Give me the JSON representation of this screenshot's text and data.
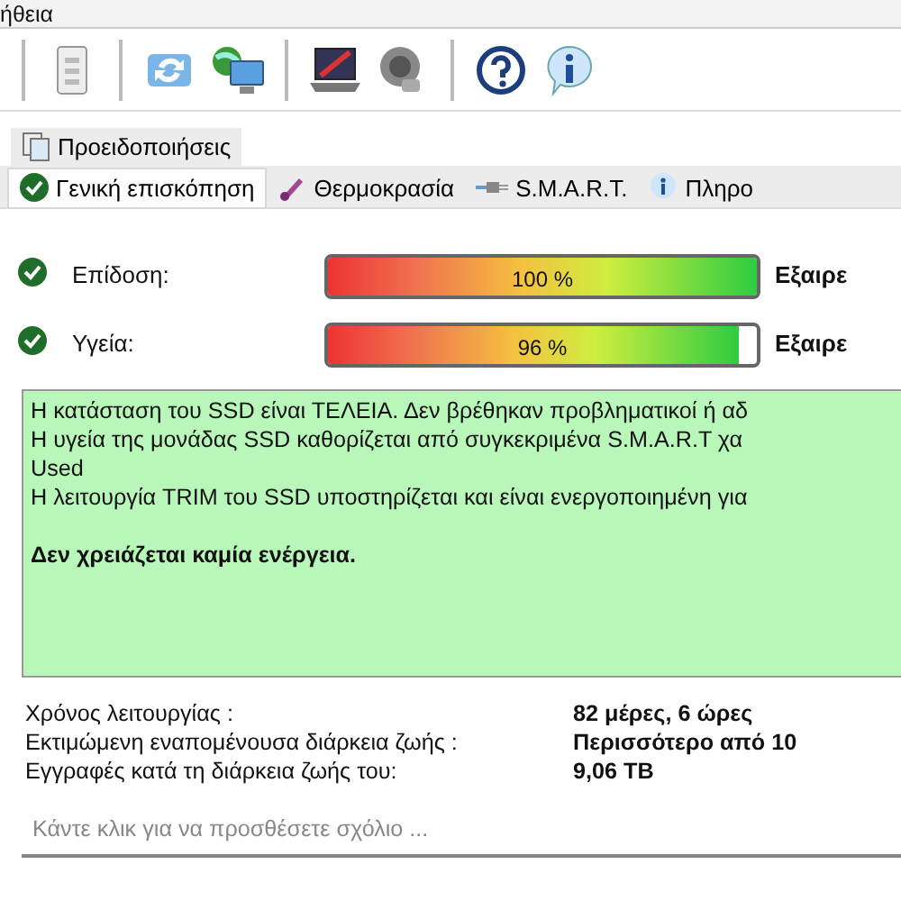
{
  "menu": [
    "ήθεια"
  ],
  "toolbar": [
    {
      "kind": "doc"
    },
    {
      "kind": "refresh"
    },
    {
      "kind": "network"
    },
    {
      "kind": "laptop"
    },
    {
      "kind": "speaker"
    },
    {
      "kind": "help"
    },
    {
      "kind": "info"
    }
  ],
  "tabs_top": [
    {
      "label": "Προειδοποιήσεις",
      "selected": false
    }
  ],
  "tabs": [
    {
      "label": "Γενική επισκόπηση",
      "selected": true,
      "kind": "check"
    },
    {
      "label": "Θερμοκρασία",
      "selected": false,
      "kind": "thermo"
    },
    {
      "label": "S.M.A.R.T.",
      "selected": false,
      "kind": "cable"
    },
    {
      "label": "Πληρο",
      "selected": false,
      "kind": "info"
    }
  ],
  "metrics": [
    {
      "label": "Επίδοση:",
      "level": 1.0,
      "reading": "100 %",
      "rating": "Εξαιρε"
    },
    {
      "label": "Υγεία:",
      "level": 0.96,
      "reading": "96 %",
      "rating": "Εξαιρε"
    }
  ],
  "message": [
    {
      "bold": false,
      "lines": [
        "Η κατάσταση του SSD είναι ΤΕΛΕΙΑ. Δεν βρέθηκαν προβληματικοί ή αδ",
        "Η υγεία  της μονάδας SSD καθορίζεται από συγκεκριμένα S.M.A.R.T χα",
        "Used",
        "Η λειτουργία TRIM του SSD υποστηρίζεται και είναι ενεργοποιημένη για"
      ]
    },
    {
      "bold": true,
      "lines": [
        "Δεν χρειάζεται καμία ενέργεια."
      ]
    }
  ],
  "info": [
    {
      "label": "Χρόνος λειτουργίας :",
      "value": "82 μέρες, 6 ώρες"
    },
    {
      "label": "Εκτιμώμενη εναπομένουσα διάρκεια ζωής :",
      "value": "Περισσότερο από 10"
    },
    {
      "label": "Εγγραφές κατά τη διάρκεια ζωής του:",
      "value": "9,06 TB"
    }
  ],
  "comment": {
    "placeholder": "Κάντε κλικ για να προσθέσετε σχόλιο ..."
  }
}
